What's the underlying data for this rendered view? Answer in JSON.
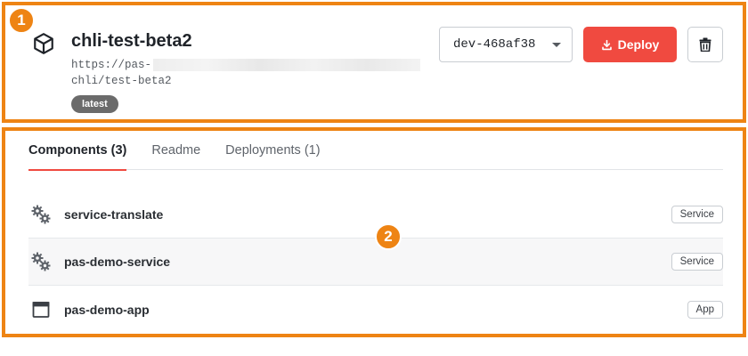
{
  "header": {
    "title": "chli-test-beta2",
    "url_line1": "https://pas-",
    "url_line2": "chli/test-beta2",
    "tag": "latest",
    "icon": "package-cube-icon"
  },
  "actions": {
    "version_select": "dev-468af38",
    "deploy_label": "Deploy",
    "deploy_color": "#f04a40",
    "delete_icon": "trash-icon"
  },
  "tabs": [
    {
      "label": "Components (3)",
      "active": true
    },
    {
      "label": "Readme",
      "active": false
    },
    {
      "label": "Deployments (1)",
      "active": false
    }
  ],
  "components": [
    {
      "name": "service-translate",
      "type": "Service",
      "icon": "gears-icon"
    },
    {
      "name": "pas-demo-service",
      "type": "Service",
      "icon": "gears-icon"
    },
    {
      "name": "pas-demo-app",
      "type": "App",
      "icon": "app-window-icon"
    }
  ],
  "annotations": {
    "marker_1": "1",
    "marker_2": "2",
    "frame_color": "#ee8414"
  }
}
